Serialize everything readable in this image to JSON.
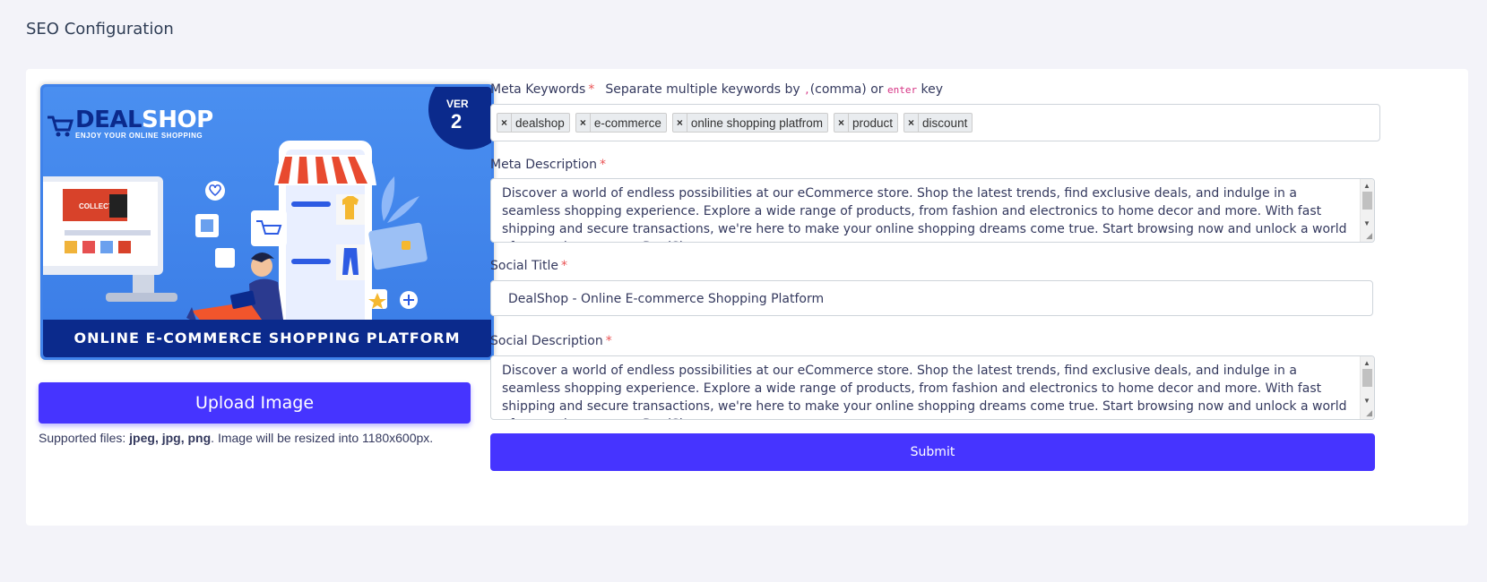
{
  "page": {
    "title": "SEO Configuration"
  },
  "preview": {
    "brand_light": "DEAL",
    "brand_dark": "SHOP",
    "tagline": "ENJOY YOUR ONLINE SHOPPING",
    "badge_line1": "VER",
    "badge_line2": "2",
    "footer_text": "ONLINE E-COMMERCE SHOPPING PLATFORM",
    "screen_text": "COLLECTION"
  },
  "upload": {
    "button_label": "Upload Image",
    "supported_prefix": "Supported files: ",
    "supported_types": "jpeg, jpg, png",
    "supported_suffix": ". Image will be resized into 1180x600px."
  },
  "meta_keywords": {
    "label": "Meta Keywords",
    "required_mark": "*",
    "hint_part1": "Separate multiple keywords by ",
    "hint_code1": ",",
    "hint_part2": "(comma) or ",
    "hint_code2": "enter",
    "hint_part3": " key",
    "tags": [
      {
        "text": "dealshop"
      },
      {
        "text": "e-commerce"
      },
      {
        "text": "online shopping platfrom"
      },
      {
        "text": "product"
      },
      {
        "text": "discount"
      }
    ],
    "remove_symbol": "×"
  },
  "meta_description": {
    "label": "Meta Description",
    "required_mark": "*",
    "value": "Discover a world of endless possibilities at our eCommerce store. Shop the latest trends, find exclusive deals, and indulge in a seamless shopping experience. Explore a wide range of products, from fashion and electronics to home decor and more. With fast shipping and secure transactions, we're here to make your online shopping dreams come true. Start browsing now and unlock a world of convenience at our DealShop."
  },
  "social_title": {
    "label": "Social Title",
    "required_mark": "*",
    "value": "DealShop - Online E-commerce Shopping Platform"
  },
  "social_description": {
    "label": "Social Description",
    "required_mark": "*",
    "value": "Discover a world of endless possibilities at our eCommerce store. Shop the latest trends, find exclusive deals, and indulge in a seamless shopping experience. Explore a wide range of products, from fashion and electronics to home decor and more. With fast shipping and secure transactions, we're here to make your online shopping dreams come true. Start browsing now and unlock a world of convenience at our DealShop."
  },
  "submit": {
    "label": "Submit"
  },
  "colors": {
    "accent": "#4634ff",
    "required": "#ea5455",
    "banner_bg": "#3f82ea",
    "banner_dark": "#0b2a8c"
  },
  "icons": {
    "cart": "cart-icon",
    "scroll_up": "arrow-up-icon",
    "scroll_down": "arrow-down-icon",
    "resize": "resize-grip-icon"
  }
}
